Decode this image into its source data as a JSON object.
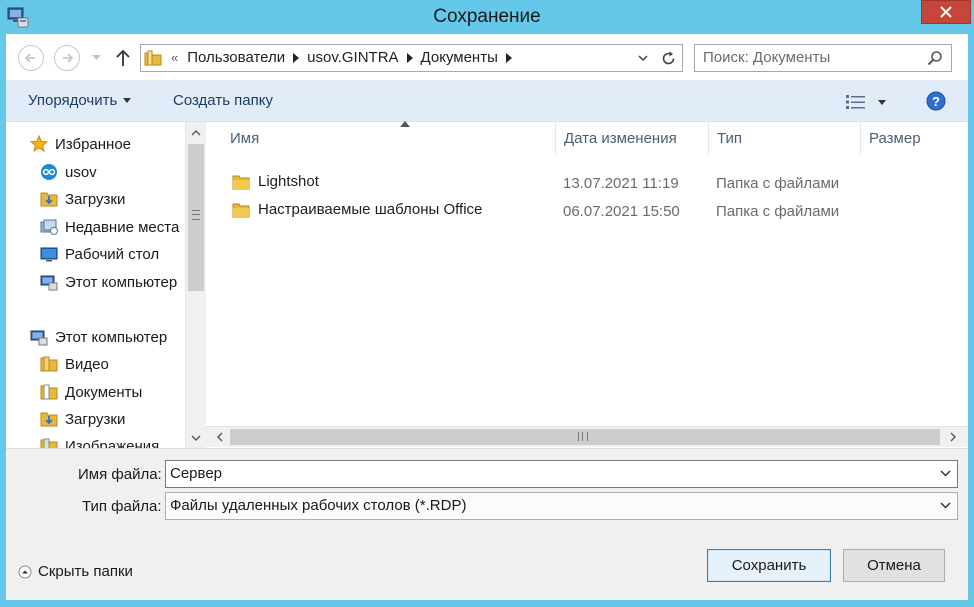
{
  "window": {
    "title": "Сохранение"
  },
  "address_bar": {
    "overflow": "«",
    "crumbs": [
      "Пользователи",
      "usov.GINTRA",
      "Документы"
    ]
  },
  "search": {
    "placeholder": "Поиск: Документы"
  },
  "toolbar": {
    "organize_label": "Упорядочить",
    "new_folder_label": "Создать папку"
  },
  "nav_pane": {
    "favorites_group": "Избранное",
    "favorites": [
      "usov",
      "Загрузки",
      "Недавние места",
      "Рабочий стол",
      "Этот компьютер"
    ],
    "computer_group": "Этот компьютер",
    "computer": [
      "Видео",
      "Документы",
      "Загрузки",
      "Изображения"
    ]
  },
  "columns": {
    "name": "Имя",
    "date": "Дата изменения",
    "type": "Тип",
    "size": "Размер"
  },
  "files": [
    {
      "name": "Lightshot",
      "date": "13.07.2021 11:19",
      "type": "Папка с файлами"
    },
    {
      "name": "Настраиваемые шаблоны Office",
      "date": "06.07.2021 15:50",
      "type": "Папка с файлами"
    }
  ],
  "form": {
    "filename_label": "Имя файла:",
    "filename_value": "Сервер",
    "filetype_label": "Тип файла:",
    "filetype_value": "Файлы удаленных рабочих столов (*.RDP)"
  },
  "footer": {
    "hide_folders_label": "Скрыть папки",
    "save_label": "Сохранить",
    "cancel_label": "Отмена"
  },
  "colors": {
    "title_bar": "#66c8e8",
    "close_button": "#c7463b",
    "toolbar": "#e1ecf8",
    "folder": "#e8b83c"
  }
}
